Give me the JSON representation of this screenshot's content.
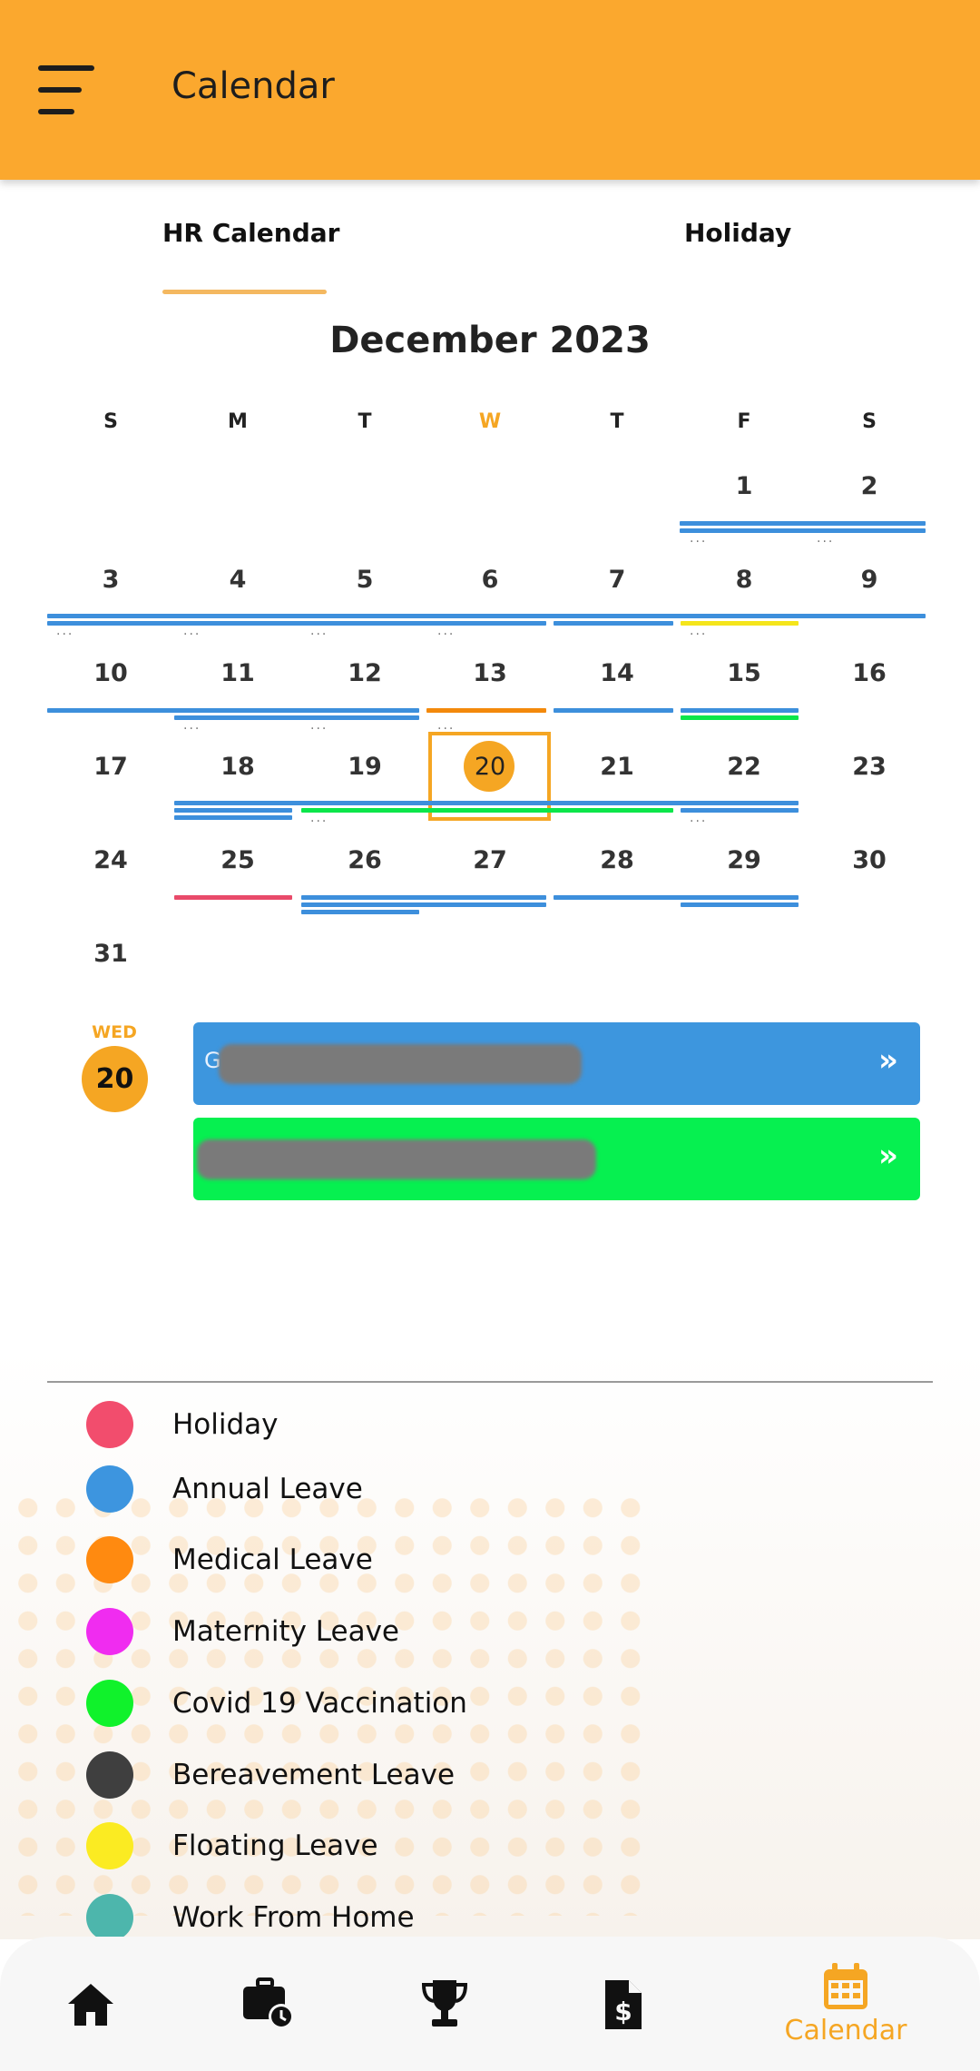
{
  "app_bar": {
    "title": "Calendar",
    "menu_icon": "hamburger-menu-icon"
  },
  "tabs": [
    {
      "label": "HR Calendar",
      "active": true
    },
    {
      "label": "Holiday",
      "active": false
    }
  ],
  "calendar": {
    "month_title": "December 2023",
    "weekdays": [
      "S",
      "M",
      "T",
      "W",
      "T",
      "F",
      "S"
    ],
    "today_weekday_index": 3,
    "selected_day": "20",
    "weeks": [
      [
        "",
        "",
        "",
        "",
        "",
        "1",
        "2"
      ],
      [
        "3",
        "4",
        "5",
        "6",
        "7",
        "8",
        "9"
      ],
      [
        "10",
        "11",
        "12",
        "13",
        "14",
        "15",
        "16"
      ],
      [
        "17",
        "18",
        "19",
        "20",
        "21",
        "22",
        "23"
      ],
      [
        "24",
        "25",
        "26",
        "27",
        "28",
        "29",
        "30"
      ],
      [
        "31",
        "",
        "",
        "",
        "",
        "",
        ""
      ]
    ],
    "more_indicator": "...",
    "colors": {
      "annual": "#3D8FDC",
      "medical": "#F3890B",
      "covid": "#0BE64A",
      "holiday": "#E94A6A",
      "floating": "#F5E51B",
      "accent": "#F5A623"
    }
  },
  "agenda": {
    "weekday": "WED",
    "date": "20",
    "events": [
      {
        "color": "#3D96DE",
        "initial": "G",
        "arrow": "»"
      },
      {
        "color": "#06F050",
        "initial": "",
        "arrow": "»"
      }
    ]
  },
  "legend": [
    {
      "label": "Holiday",
      "color": "#F24D6D"
    },
    {
      "label": "Annual Leave",
      "color": "#3D95DF"
    },
    {
      "label": "Medical Leave",
      "color": "#FF8A10"
    },
    {
      "label": "Maternity Leave",
      "color": "#F02CF0"
    },
    {
      "label": "Covid 19 Vaccination",
      "color": "#10F22B"
    },
    {
      "label": "Bereavement Leave",
      "color": "#3F3F3F"
    },
    {
      "label": "Floating Leave",
      "color": "#FBEB22"
    },
    {
      "label": "Work From Home",
      "color": "#4DB6AC"
    }
  ],
  "bottom_nav": [
    {
      "icon": "home-icon",
      "label": ""
    },
    {
      "icon": "briefcase-clock-icon",
      "label": ""
    },
    {
      "icon": "trophy-icon",
      "label": ""
    },
    {
      "icon": "invoice-dollar-icon",
      "label": ""
    },
    {
      "icon": "calendar-icon",
      "label": "Calendar",
      "active": true
    }
  ]
}
